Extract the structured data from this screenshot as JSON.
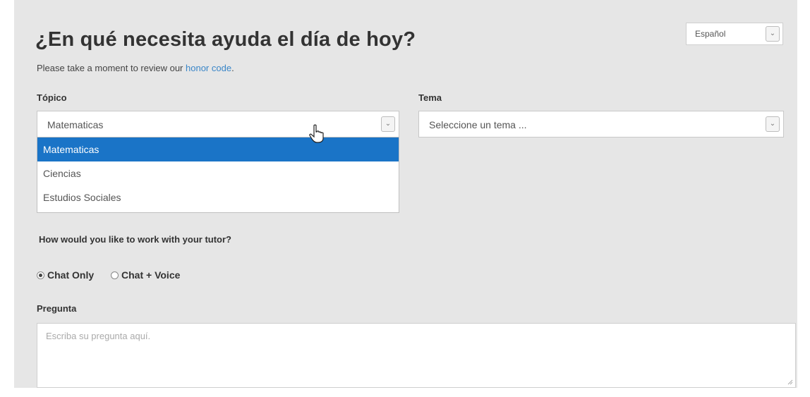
{
  "header": {
    "title": "¿En qué necesita ayuda el día de hoy?",
    "honor_prefix": "Please take a moment to review our ",
    "honor_link": "honor code",
    "honor_suffix": "."
  },
  "language_select": {
    "value": "Español"
  },
  "topic": {
    "label": "Tópico",
    "value": "Matematicas",
    "options": [
      "Matematicas",
      "Ciencias",
      "Estudios Sociales"
    ],
    "selected_index": 0
  },
  "theme": {
    "label": "Tema",
    "placeholder": "Seleccione un tema ..."
  },
  "work_mode": {
    "question": "How would you like to work with your tutor?",
    "options": [
      "Chat Only",
      "Chat + Voice"
    ],
    "selected": "Chat Only"
  },
  "question": {
    "label": "Pregunta",
    "placeholder": "Escriba su pregunta aquí."
  },
  "colors": {
    "panel_bg": "#e6e6e6",
    "highlight": "#1a74c7",
    "link": "#3a86c8"
  },
  "icons": [
    "chevron-down-icon",
    "hand-pointer-icon",
    "resize-grip-icon"
  ]
}
